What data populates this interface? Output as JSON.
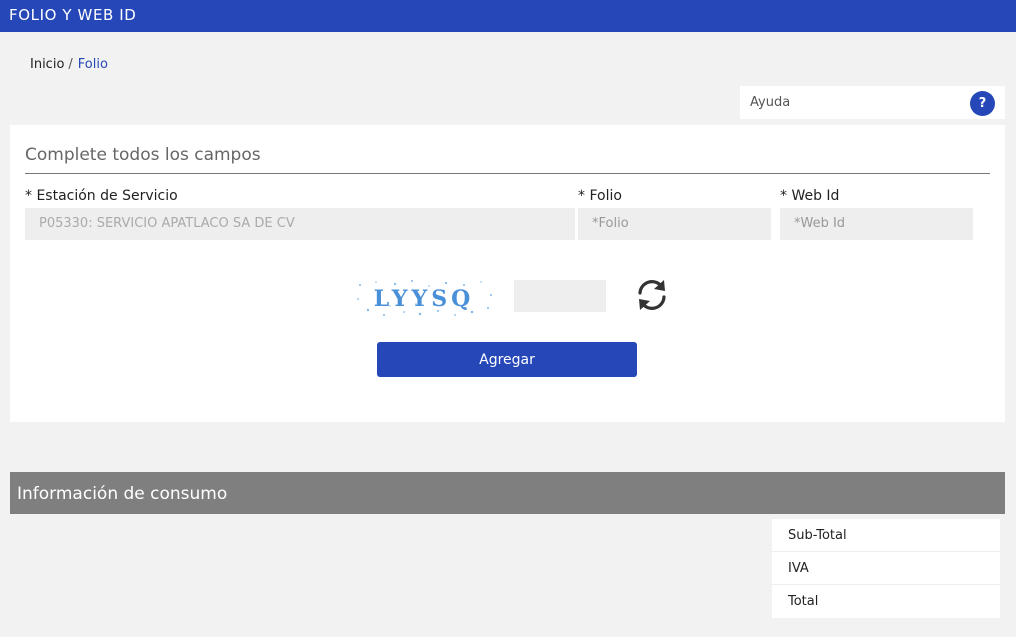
{
  "header": {
    "title": "FOLIO Y WEB ID",
    "color": "#2547b8"
  },
  "breadcrumb": {
    "home": "Inicio",
    "separator": "/",
    "current": "Folio"
  },
  "help": {
    "label": "Ayuda",
    "icon_text": "?"
  },
  "form": {
    "heading": "Complete todos los campos",
    "estacion": {
      "label": "* Estación de Servicio",
      "value": "P05330: SERVICIO APATLACO SA DE CV"
    },
    "folio": {
      "label": "* Folio",
      "placeholder": "*Folio"
    },
    "webid": {
      "label": "* Web Id",
      "placeholder": "*Web Id"
    },
    "captcha": {
      "text": "LYYSQ",
      "input_value": ""
    },
    "submit_label": "Agregar"
  },
  "consumo": {
    "title": "Información de consumo",
    "rows": [
      "Sub-Total",
      "IVA",
      "Total"
    ]
  },
  "icons": {
    "refresh": "refresh-icon",
    "help": "help-icon"
  }
}
